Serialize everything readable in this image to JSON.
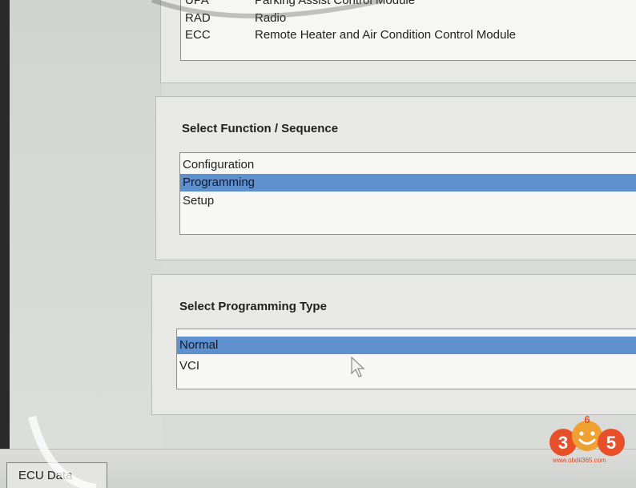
{
  "ecu_list": {
    "rows": [
      {
        "code": "UPA",
        "name": "Parking Assist Control Module"
      },
      {
        "code": "RAD",
        "name": "Radio"
      },
      {
        "code": "ECC",
        "name": "Remote Heater and Air Condition Control Module"
      }
    ]
  },
  "function_section": {
    "title": "Select Function / Sequence",
    "items": [
      "Configuration",
      "Programming",
      "Setup"
    ],
    "selected": "Programming"
  },
  "programming_section": {
    "title": "Select Programming Type",
    "items": [
      "Normal",
      "VCI"
    ],
    "selected": "Normal"
  },
  "bottom_tabs": {
    "ecu_data": "ECU Data"
  },
  "watermark": {
    "logo_digits": [
      "3",
      "6",
      "5"
    ],
    "url": "www.obdii365.com",
    "brand_color": "#e8502a"
  },
  "icons": {
    "cursor": "mouse-pointer-icon"
  }
}
